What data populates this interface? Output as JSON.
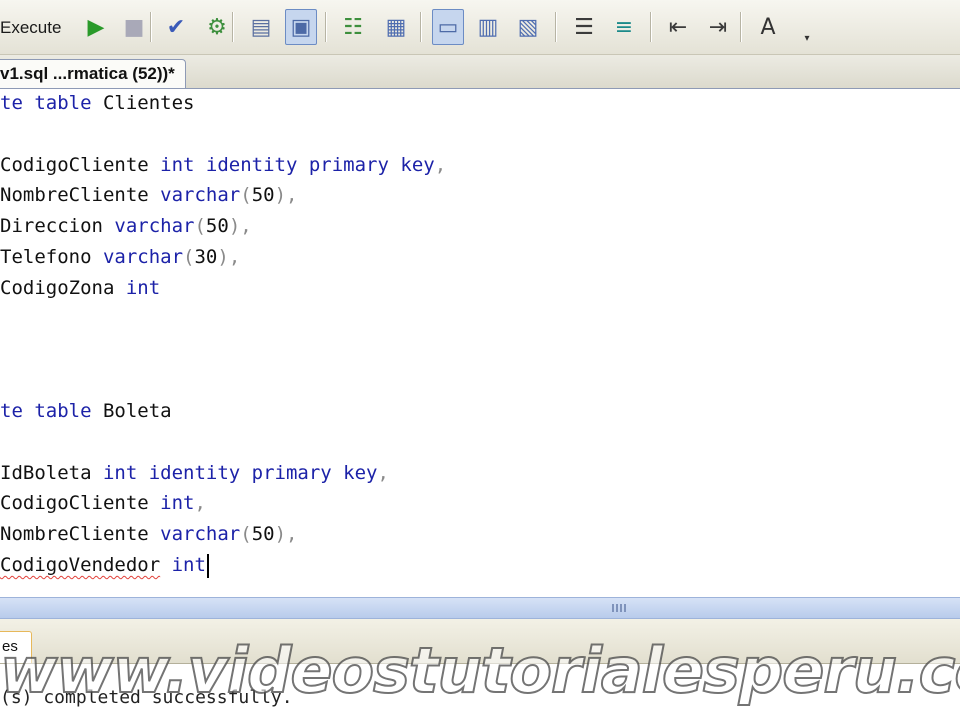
{
  "toolbar": {
    "execute_label": "Execute",
    "buttons": [
      {
        "name": "run-icon",
        "glyph": "▶",
        "color": "#2a9a2a"
      },
      {
        "name": "stop-icon",
        "glyph": "■",
        "color": "#a9a9b8"
      },
      {
        "name": "parse-checkmark-icon",
        "glyph": "✔",
        "color": "#3a5ab8"
      },
      {
        "name": "display-plan-icon",
        "glyph": "⚙",
        "color": "#3d8f3d"
      },
      {
        "name": "query-designer-icon",
        "glyph": "▤",
        "color": "#5a6fa0"
      },
      {
        "name": "include-plan-icon",
        "glyph": "▣",
        "color": "#4d6aa6"
      },
      {
        "name": "results-to-text-icon",
        "glyph": "☷",
        "color": "#3d8f3d"
      },
      {
        "name": "results-to-grid-icon",
        "glyph": "▦",
        "color": "#4f6db0"
      },
      {
        "name": "results-to-file-icon",
        "glyph": "▭",
        "color": "#4d6aa6"
      },
      {
        "name": "comment-icon",
        "glyph": "▥",
        "color": "#4f6db0"
      },
      {
        "name": "uncomment-icon",
        "glyph": "▧",
        "color": "#4f6db0"
      },
      {
        "name": "decrease-indent-icon",
        "glyph": "☰",
        "color": "#3b3b3b"
      },
      {
        "name": "increase-indent-icon",
        "glyph": "≡",
        "color": "#1c8a8a"
      },
      {
        "name": "outdent-icon",
        "glyph": "⇤",
        "color": "#3b3b3b"
      },
      {
        "name": "indent-icon",
        "glyph": "⇥",
        "color": "#3b3b3b"
      },
      {
        "name": "specify-values-icon",
        "glyph": "A",
        "color": "#333333"
      }
    ],
    "overflow_glyph": "▾"
  },
  "tab": {
    "label": "v1.sql ...rmatica (52))*"
  },
  "editor": {
    "lines": [
      [
        {
          "t": "te ",
          "c": "keyword"
        },
        {
          "t": "table",
          "c": "keyword"
        },
        {
          "t": " Clientes",
          "c": "text"
        }
      ],
      [],
      [
        {
          "t": "CodigoCliente ",
          "c": "text"
        },
        {
          "t": "int identity primary key",
          "c": "keyword"
        },
        {
          "t": ",",
          "c": "paren"
        }
      ],
      [
        {
          "t": "NombreCliente ",
          "c": "text"
        },
        {
          "t": "varchar",
          "c": "keyword"
        },
        {
          "t": "(",
          "c": "paren"
        },
        {
          "t": "50",
          "c": "text"
        },
        {
          "t": "),",
          "c": "paren"
        }
      ],
      [
        {
          "t": "Direccion ",
          "c": "text"
        },
        {
          "t": "varchar",
          "c": "keyword"
        },
        {
          "t": "(",
          "c": "paren"
        },
        {
          "t": "50",
          "c": "text"
        },
        {
          "t": "),",
          "c": "paren"
        }
      ],
      [
        {
          "t": "Telefono ",
          "c": "text"
        },
        {
          "t": "varchar",
          "c": "keyword"
        },
        {
          "t": "(",
          "c": "paren"
        },
        {
          "t": "30",
          "c": "text"
        },
        {
          "t": "),",
          "c": "paren"
        }
      ],
      [
        {
          "t": "CodigoZona ",
          "c": "text"
        },
        {
          "t": "int",
          "c": "keyword"
        }
      ],
      [],
      [],
      [],
      [
        {
          "t": "te ",
          "c": "keyword"
        },
        {
          "t": "table",
          "c": "keyword"
        },
        {
          "t": " Boleta",
          "c": "text"
        }
      ],
      [],
      [
        {
          "t": "IdBoleta ",
          "c": "text"
        },
        {
          "t": "int identity primary key",
          "c": "keyword"
        },
        {
          "t": ",",
          "c": "paren"
        }
      ],
      [
        {
          "t": "CodigoCliente ",
          "c": "text"
        },
        {
          "t": "int",
          "c": "keyword"
        },
        {
          "t": ",",
          "c": "paren"
        }
      ],
      [
        {
          "t": "NombreCliente ",
          "c": "text"
        },
        {
          "t": "varchar",
          "c": "keyword"
        },
        {
          "t": "(",
          "c": "paren"
        },
        {
          "t": "50",
          "c": "text"
        },
        {
          "t": "),",
          "c": "paren"
        }
      ],
      [
        {
          "t": "CodigoVendedor",
          "c": "text",
          "squiggle": true
        },
        {
          "t": " ",
          "c": "text"
        },
        {
          "t": "int",
          "c": "keyword",
          "caret": true
        }
      ]
    ]
  },
  "results": {
    "tab_label": "es",
    "message": "(s) completed successfully."
  },
  "watermark": "www.videostutorialesperu.com",
  "colors": {
    "keyword": "#1c22a8",
    "paren": "#8a8a8a",
    "text": "#111111",
    "splitter": "#b8cbeb"
  }
}
